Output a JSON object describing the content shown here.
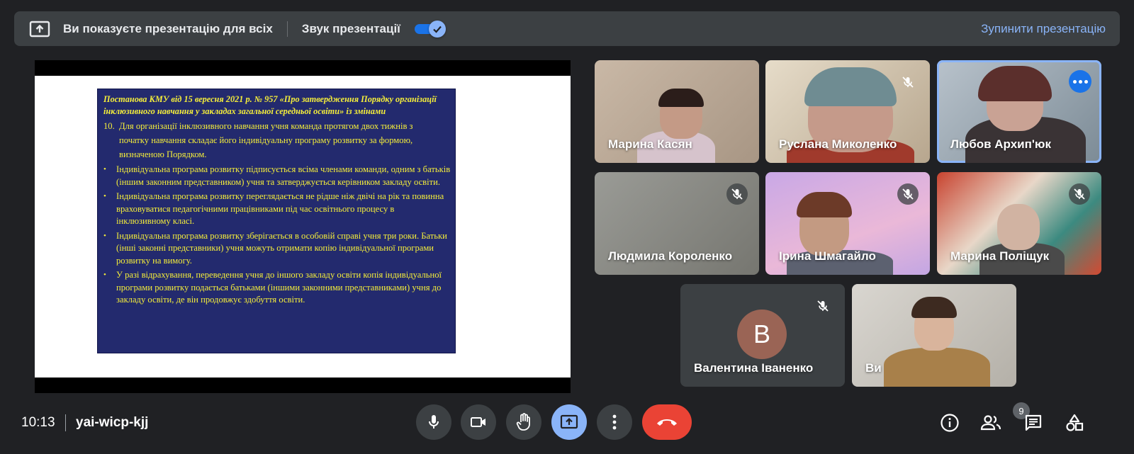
{
  "banner": {
    "presenting_text": "Ви показуєте презентацію для всіх",
    "sound_label": "Звук презентації",
    "sound_enabled": true,
    "stop_label": "Зупинити презентацію"
  },
  "slide": {
    "title": "Постанова КМУ від 15 вересня 2021 р. № 957  «Про затвердження Порядку організації інклюзивного навчання у закладах загальної середньої освіти» із змінами",
    "item_number": "10.",
    "item_first_line": "Для організації інклюзивного навчання учня команда протягом двох тижнів з",
    "item_rest": "початку навчання складає його індивідуальну програму розвитку за формою, визначеною Порядком.",
    "bullets": [
      "Індивідуальна програма розвитку підписується всіма членами команди, одним з батьків (іншим законним представником) учня та затверджується керівником закладу освіти.",
      "Індивідуальна програма розвитку переглядається не рідше ніж двічі на рік та повинна враховуватися педагогічними працівниками під час освітнього процесу в інклюзивному класі.",
      "Індивідуальна програма розвитку зберігається в особовій справі учня три роки. Батьки (інші законні представники) учня можуть отримати копію індивідуальної програми розвитку на вимогу.",
      "У разі відрахування, переведення учня до іншого закладу освіти копія індивідуальної програми розвитку подається батьками (іншими законними представниками) учня до закладу освіти, де він продовжує здобуття освіти."
    ]
  },
  "participants": [
    {
      "name": "Марина Касян",
      "muted": false
    },
    {
      "name": "Руслана Миколенко",
      "muted": true
    },
    {
      "name": "Любов Архип'юк",
      "muted": false,
      "active_speaker": true
    },
    {
      "name": "Людмила Короленко",
      "muted": true
    },
    {
      "name": "Ірина Шмагайло",
      "muted": true
    },
    {
      "name": "Марина Поліщук",
      "muted": true
    },
    {
      "name": "Валентина Іваненко",
      "muted": true,
      "initial": "В"
    },
    {
      "name": "Ви",
      "muted": false
    }
  ],
  "bottom": {
    "time": "10:13",
    "meeting_code": "yai-wicp-kjj",
    "participant_count": "9"
  },
  "colors": {
    "accent": "#8ab4f8",
    "hangup": "#ea4335",
    "background": "#202124"
  }
}
